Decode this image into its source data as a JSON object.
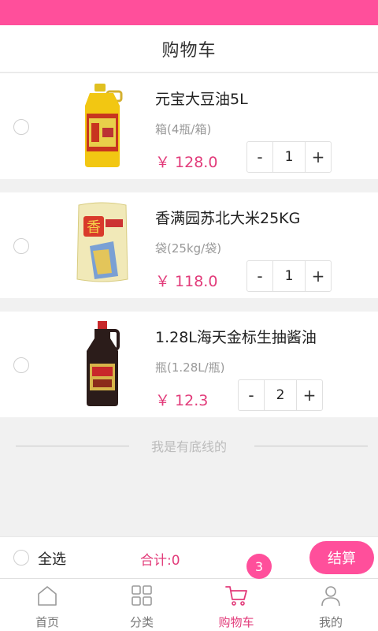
{
  "header": {
    "title": "购物车"
  },
  "cart": {
    "items": [
      {
        "name": "元宝大豆油5L",
        "spec": "箱(4瓶/箱)",
        "price": "￥ 128.0",
        "qty": "1",
        "minus": "-",
        "plus": "+",
        "image": "soybean-oil-bottle"
      },
      {
        "name": "香满园苏北大米25KG",
        "spec": "袋(25kg/袋)",
        "price": "￥ 118.0",
        "qty": "1",
        "minus": "-",
        "plus": "+",
        "image": "rice-bag"
      },
      {
        "name": "1.28L海天金标生抽酱油",
        "spec": "瓶(1.28L/瓶)",
        "price": "￥ 12.3",
        "qty": "2",
        "minus": "-",
        "plus": "+",
        "image": "soy-sauce-bottle"
      }
    ],
    "bottom_text": "我是有底线的"
  },
  "checkout": {
    "select_all": "全选",
    "total": "合计:0",
    "settle": "结算"
  },
  "tabs": [
    {
      "label": "首页",
      "icon": "home-icon",
      "active": false
    },
    {
      "label": "分类",
      "icon": "grid-icon",
      "active": false
    },
    {
      "label": "购物车",
      "icon": "cart-icon",
      "active": true,
      "badge": "3"
    },
    {
      "label": "我的",
      "icon": "user-icon",
      "active": false
    }
  ],
  "colors": {
    "accent": "#ff4f9b",
    "price": "#e23b7a",
    "background": "#f1f1f1"
  }
}
